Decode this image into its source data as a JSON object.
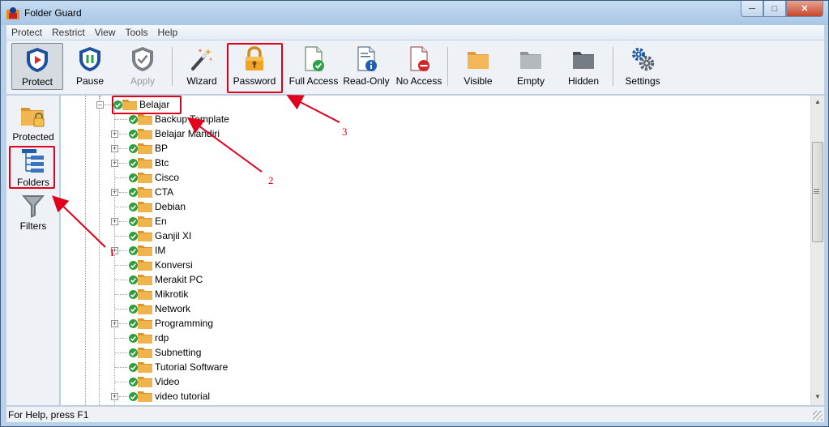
{
  "window": {
    "title": "Folder Guard"
  },
  "menu": [
    "Protect",
    "Restrict",
    "View",
    "Tools",
    "Help"
  ],
  "toolbar": {
    "buttons": [
      {
        "label": "Protect",
        "icon": "shield-play-icon"
      },
      {
        "label": "Pause",
        "icon": "shield-pause-icon"
      },
      {
        "label": "Apply",
        "icon": "shield-check-icon"
      },
      {
        "label": "Wizard",
        "icon": "magic-wand-icon"
      },
      {
        "label": "Password",
        "icon": "padlock-icon"
      },
      {
        "label": "Full Access",
        "icon": "document-check-icon"
      },
      {
        "label": "Read-Only",
        "icon": "document-info-icon"
      },
      {
        "label": "No Access",
        "icon": "document-blocked-icon"
      },
      {
        "label": "Visible",
        "icon": "folder-orange-icon"
      },
      {
        "label": "Empty",
        "icon": "folder-gray-icon"
      },
      {
        "label": "Hidden",
        "icon": "folder-dark-icon"
      },
      {
        "label": "Settings",
        "icon": "gears-icon"
      }
    ]
  },
  "leftnav": {
    "items": [
      {
        "label": "Protected",
        "icon": "folder-lock-icon"
      },
      {
        "label": "Folders",
        "icon": "folder-tree-icon"
      },
      {
        "label": "Filters",
        "icon": "funnel-icon"
      }
    ]
  },
  "tree": {
    "root": {
      "label": "Belajar",
      "expanded": true
    },
    "children": [
      {
        "label": "Backup Template",
        "has_children": false
      },
      {
        "label": "Belajar Mandiri",
        "has_children": true
      },
      {
        "label": "BP",
        "has_children": true
      },
      {
        "label": "Btc",
        "has_children": true
      },
      {
        "label": "Cisco",
        "has_children": false
      },
      {
        "label": "CTA",
        "has_children": true
      },
      {
        "label": "Debian",
        "has_children": false
      },
      {
        "label": "En",
        "has_children": true
      },
      {
        "label": "Ganjil XI",
        "has_children": false
      },
      {
        "label": "IM",
        "has_children": true
      },
      {
        "label": "Konversi",
        "has_children": false
      },
      {
        "label": "Merakit PC",
        "has_children": false
      },
      {
        "label": "Mikrotik",
        "has_children": false
      },
      {
        "label": "Network",
        "has_children": false
      },
      {
        "label": "Programming",
        "has_children": true
      },
      {
        "label": "rdp",
        "has_children": false
      },
      {
        "label": "Subnetting",
        "has_children": false
      },
      {
        "label": "Tutorial Software",
        "has_children": false
      },
      {
        "label": "Video",
        "has_children": false
      },
      {
        "label": "video tutorial",
        "has_children": true
      }
    ]
  },
  "status": {
    "text": "For Help, press F1"
  },
  "annotations": {
    "one": "1",
    "two": "2",
    "three": "3"
  },
  "colors": {
    "highlight": "#e0001b",
    "folder": "#f0b44c",
    "check": "#2e9e3e"
  }
}
